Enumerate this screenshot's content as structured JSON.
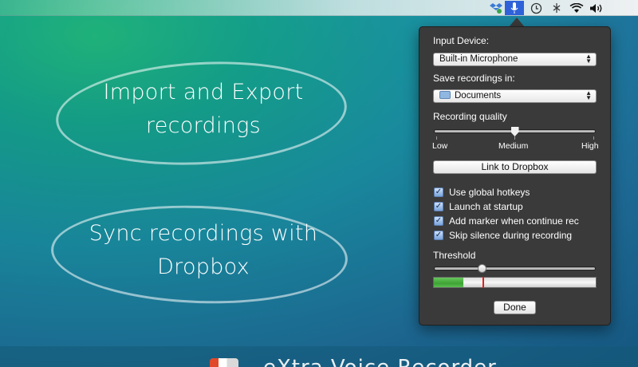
{
  "menubar": {
    "icons": [
      "dropbox-sync-icon",
      "microphone-icon",
      "time-machine-icon",
      "bluetooth-icon",
      "wifi-icon",
      "volume-icon"
    ]
  },
  "promo": {
    "oval1_text": "Import and Export recordings",
    "oval2_text": "Sync recordings with Dropbox",
    "banner_text": "eXtra Voice Recorder"
  },
  "settings": {
    "input_device_label": "Input Device:",
    "input_device_value": "Built-in Microphone",
    "save_label": "Save recordings in:",
    "save_value": "Documents",
    "quality_label": "Recording quality",
    "quality_low": "Low",
    "quality_medium": "Medium",
    "quality_high": "High",
    "quality_level": 0.5,
    "link_button": "Link to Dropbox",
    "checkboxes": [
      {
        "label": "Use global hotkeys",
        "checked": true
      },
      {
        "label": "Launch at startup",
        "checked": true
      },
      {
        "label": "Add marker when continue rec",
        "checked": true
      },
      {
        "label": "Skip silence during recording",
        "checked": true
      }
    ],
    "threshold_label": "Threshold",
    "threshold_level": 0.3,
    "meter_level": 0.18,
    "done_button": "Done"
  },
  "colors": {
    "popover_bg": "#3a3a3a",
    "menubar_active": "#2f62d9",
    "meter_green": "#3ea334",
    "meter_marker": "#e02020"
  }
}
